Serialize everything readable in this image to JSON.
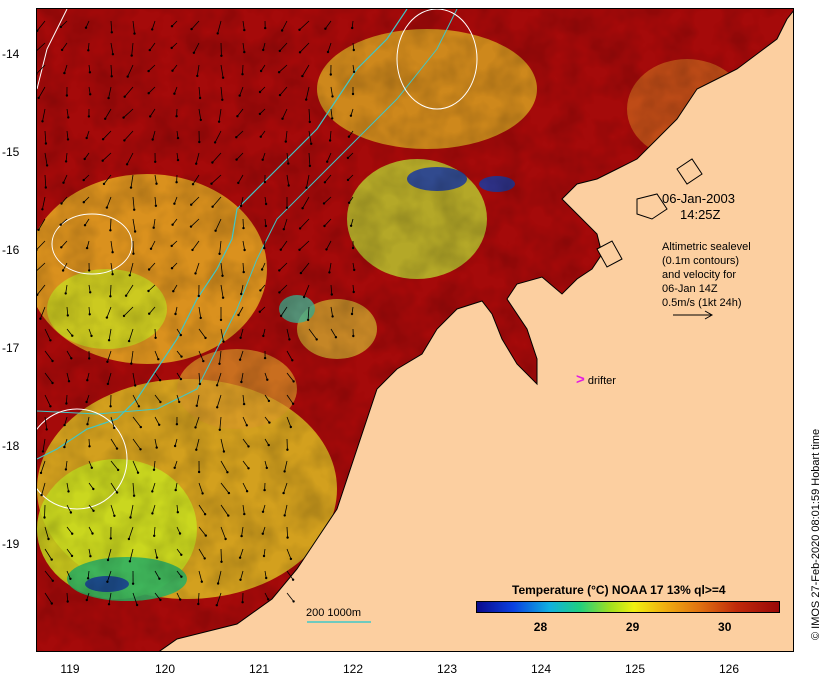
{
  "map": {
    "x_ticks": [
      "119",
      "120",
      "121",
      "122",
      "123",
      "124",
      "125",
      "126"
    ],
    "y_ticks": [
      "-14",
      "-15",
      "-16",
      "-17",
      "-18",
      "-19"
    ],
    "date": "06-Jan-2003",
    "time": "14:25Z",
    "info_lines": [
      "Altimetric sealevel",
      "(0.1m contours)",
      "and velocity for",
      "06-Jan 14Z",
      "0.5m/s (1kt 24h)"
    ],
    "drifter_symbol": ">",
    "drifter_label": "drifter",
    "scale_label": "200  1000m",
    "credit": "© IMOS 27-Feb-2020 08:01:59 Hobart time",
    "colors": {
      "land": "#fccfa0",
      "sea_hot": "#a50a0a",
      "drifter": "#e21ce2",
      "contour": "#40c8c8"
    }
  },
  "legend": {
    "title": "Temperature (°C) NOAA 17 13% ql>=4",
    "ticks": [
      {
        "label": "28",
        "value": 28
      },
      {
        "label": "29",
        "value": 29
      },
      {
        "label": "30",
        "value": 30
      }
    ],
    "range": [
      27.3,
      30.6
    ]
  }
}
